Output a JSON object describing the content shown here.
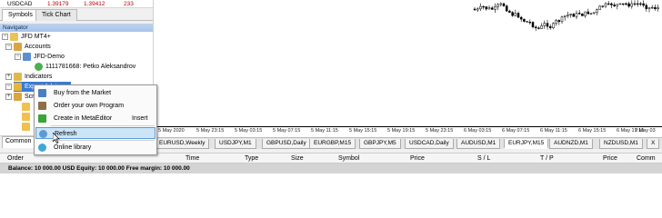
{
  "market_watch": {
    "symbol": "USDCAD",
    "bid": "1.39179",
    "ask": "1.39412",
    "spread": "233"
  },
  "panel_tabs": [
    "Symbols",
    "Tick Chart"
  ],
  "navigator": {
    "title": "Navigator",
    "root": "JFD MT4+",
    "accounts": "Accounts",
    "server": "JFD-Demo",
    "account": "1111781668: Petko Aleksandrov",
    "indicators": "Indicators",
    "expert_advisors": "Expert Advisors",
    "scripts": "Scripts",
    "bottom_tab": "Common"
  },
  "context_menu": {
    "items": [
      {
        "label": "Buy from the Market",
        "shortcut": "",
        "icon": "market-icon"
      },
      {
        "label": "Order your own Program",
        "shortcut": "",
        "icon": "briefcase-icon"
      },
      {
        "label": "Create in MetaEditor",
        "shortcut": "Insert",
        "icon": "plus-icon"
      },
      {
        "label": "Refresh",
        "shortcut": "",
        "icon": "refresh-icon"
      },
      {
        "label": "Online library",
        "shortcut": "",
        "icon": "globe-icon"
      }
    ],
    "highlighted": "Refresh"
  },
  "time_axis": [
    "5 May 2020",
    "5 May 23:15",
    "5 May 03:15",
    "5 May 07:15",
    "5 May 11:15",
    "5 May 15:15",
    "5 May 19:15",
    "5 May 23:15",
    "6 May 03:15",
    "6 May 07:15",
    "6 May 11:15",
    "6 May 15:15",
    "6 May 19:15",
    "7 May 03"
  ],
  "chart_tabs": [
    "EURUSD,Weekly",
    "USDJPY,M1",
    "GBPUSD,Daily",
    "EURGBP,M15",
    "GBPJPY,M5",
    "USDCAD,Daily",
    "AUDUSD,M1",
    "EURJPY,M15",
    "AUDNZD,M1",
    "NZDUSD,M1",
    "X"
  ],
  "active_chart_tab": "EURJPY,M15",
  "terminal_columns": [
    "Order",
    "Time",
    "Type",
    "Size",
    "Symbol",
    "Price",
    "S / L",
    "T / P",
    "Price",
    "Comm"
  ],
  "balance_line": "Balance: 10 000.00 USD  Equity: 10 000.00  Free margin: 10 000.00",
  "colors": {
    "price": "#b00000",
    "highlight": "#cce4f7",
    "nav_title": "#a8c4ea"
  }
}
